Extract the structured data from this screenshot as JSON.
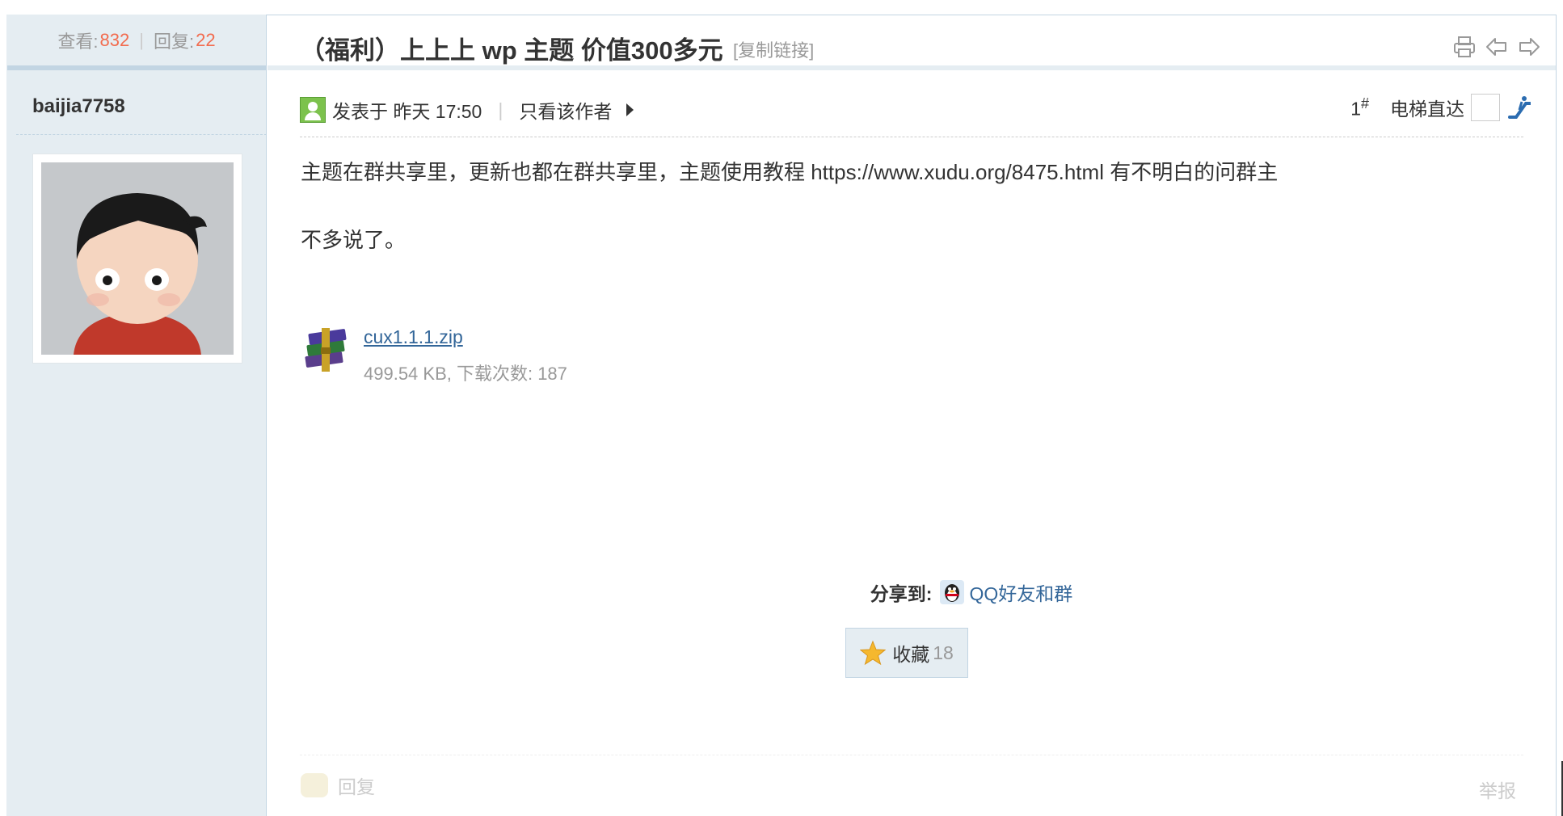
{
  "stats": {
    "views_label": "查看:",
    "views": "832",
    "replies_label": "回复:",
    "replies": "22"
  },
  "thread": {
    "title": "（福利）上上上 wp 主题 价值300多元",
    "copy_link": "[复制链接]"
  },
  "author": {
    "name": "baijia7758"
  },
  "post": {
    "posted_label": "发表于 昨天 17:50",
    "only_author": "只看该作者",
    "floor": "1",
    "floor_sup": "#",
    "elevator": "电梯直达",
    "lines": [
      "主题在群共享里，更新也都在群共享里，主题使用教程 https://www.xudu.org/8475.html  有不明白的问群主",
      "不多说了。"
    ]
  },
  "attachment": {
    "filename": "cux1.1.1.zip",
    "meta": "499.54 KB, 下载次数: 187"
  },
  "share": {
    "label": "分享到:",
    "target": "QQ好友和群"
  },
  "favorite": {
    "label": "收藏",
    "count": "18"
  },
  "footer": {
    "reply": "回复",
    "report": "举报"
  }
}
